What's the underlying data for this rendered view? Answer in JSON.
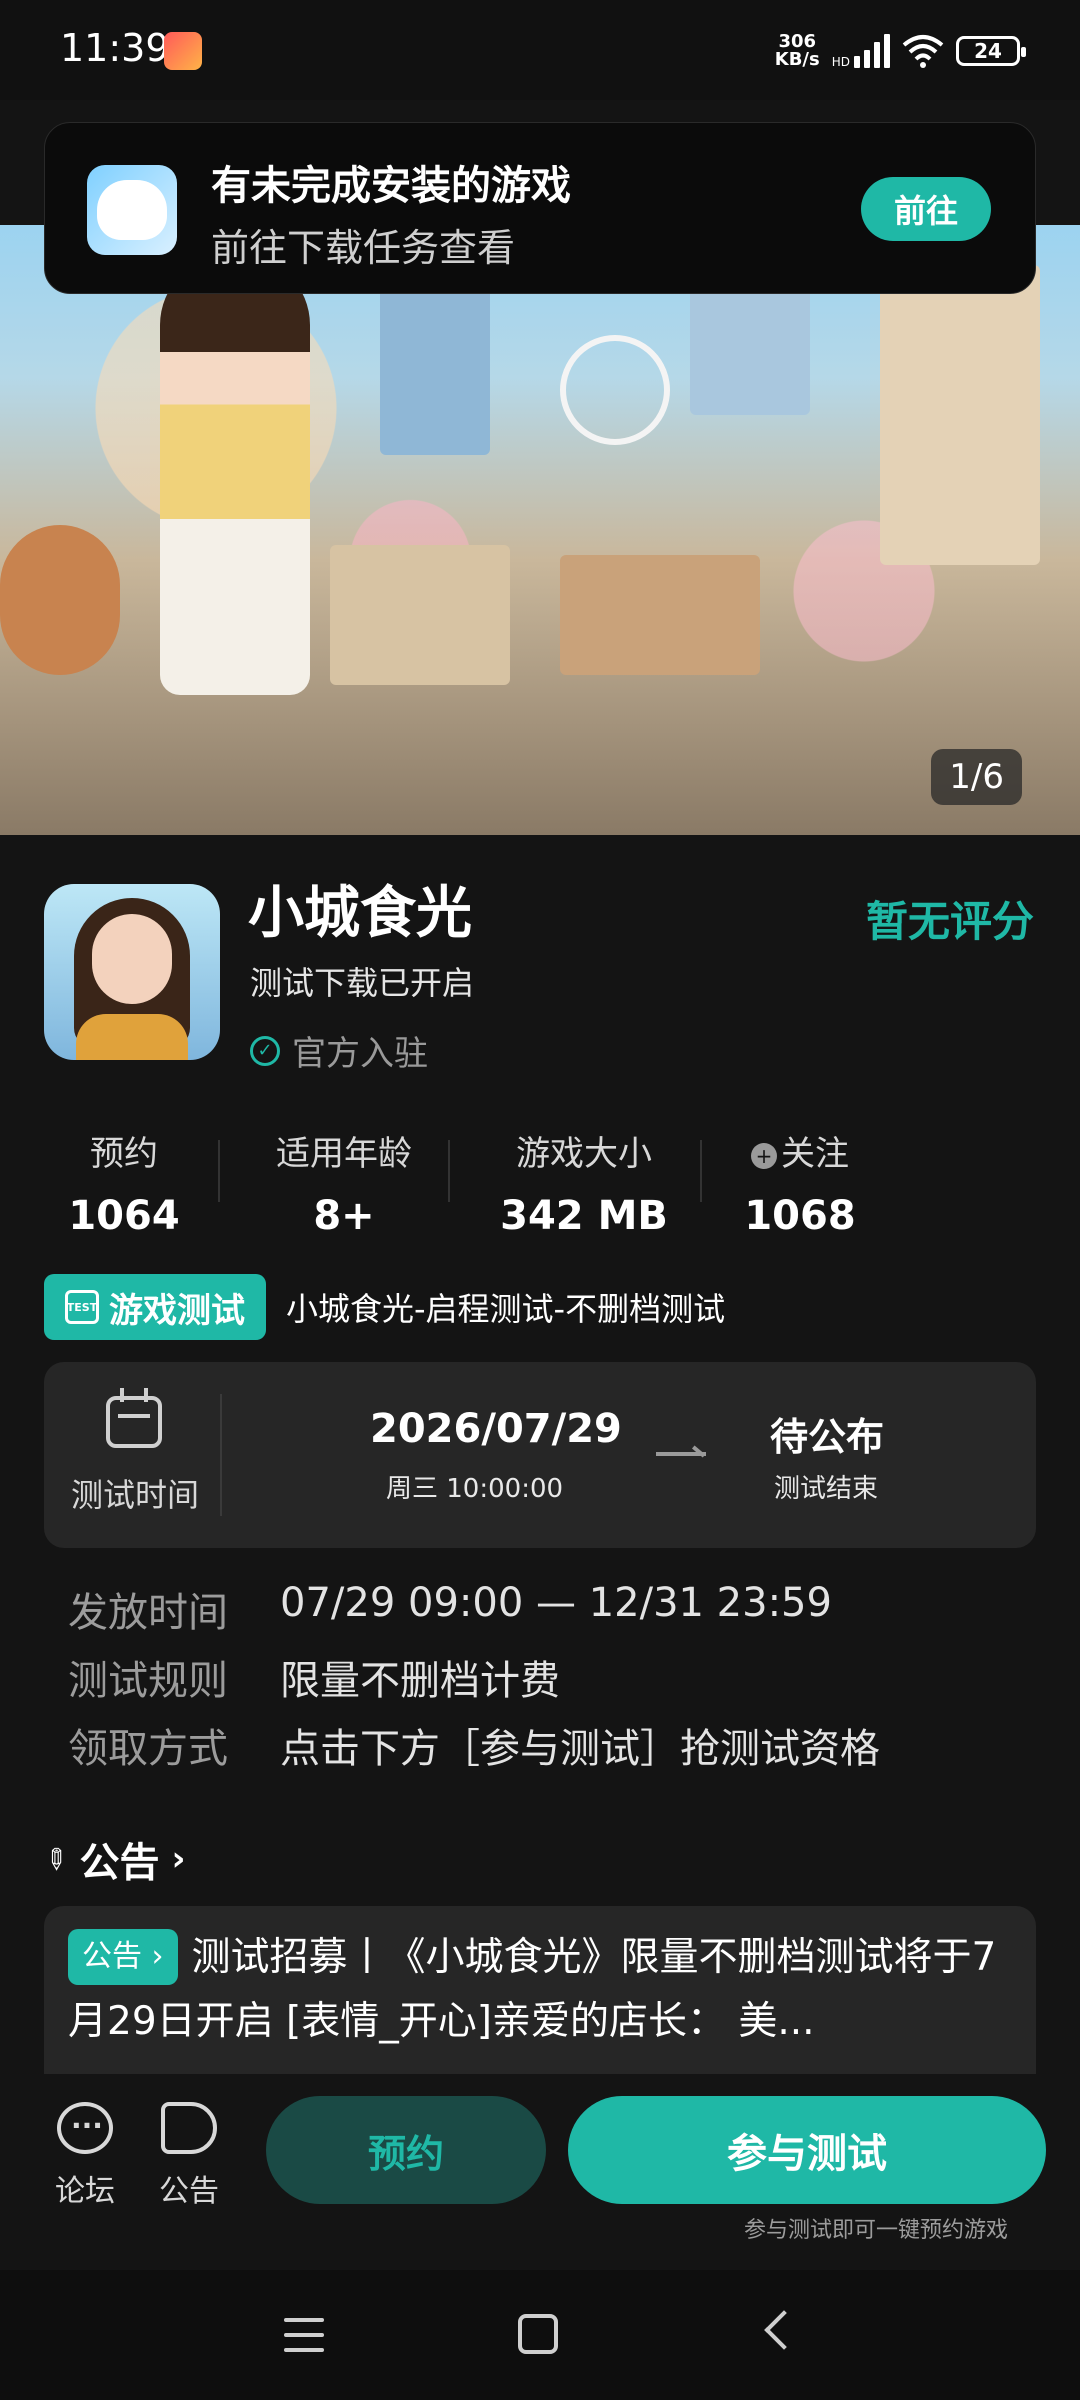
{
  "status_bar": {
    "time": "11:39",
    "net_speed_value": "306",
    "net_speed_unit": "KB/s",
    "signal_label": "HD",
    "battery": "24"
  },
  "notification": {
    "title": "有未完成安装的游戏",
    "subtitle": "前往下载任务查看",
    "button_label": "前往"
  },
  "hero": {
    "counter": "1/6"
  },
  "game": {
    "title": "小城食光",
    "status": "测试下载已开启",
    "official_label": "官方入驻",
    "rating": "暂无评分"
  },
  "stats": [
    {
      "label": "预约",
      "value": "1064"
    },
    {
      "label": "适用年龄",
      "value": "8+"
    },
    {
      "label": "游戏大小",
      "value": "342 MB"
    },
    {
      "label": "关注",
      "value": "1068"
    }
  ],
  "test": {
    "tag_label": "游戏测试",
    "tag_icon_text": "TEST",
    "name": "小城食光-启程测试-不删档测试",
    "time_label": "测试时间",
    "start_date": "2026/07/29",
    "start_time": "周三  10:00:00",
    "end_date": "待公布",
    "end_label": "测试结束"
  },
  "details": [
    {
      "key": "发放时间",
      "value": "07/29 09:00 — 12/31 23:59"
    },
    {
      "key": "测试规则",
      "value": "限量不删档计费"
    },
    {
      "key": "领取方式",
      "value": "点击下方［参与测试］抢测试资格"
    }
  ],
  "announcement": {
    "header": "公告",
    "badge": "公告",
    "text": "测试招募丨《小城食光》限量不删档测试将于7月29日开启 [表情_开心]亲爱的店长：  美..."
  },
  "bottom_bar": {
    "forum_label": "论坛",
    "notice_label": "公告",
    "reserve_label": "预约",
    "join_label": "参与测试",
    "join_hint": "参与测试即可一键预约游戏"
  },
  "colors": {
    "accent": "#1fb8a6",
    "background": "#141414",
    "card": "#262626"
  }
}
